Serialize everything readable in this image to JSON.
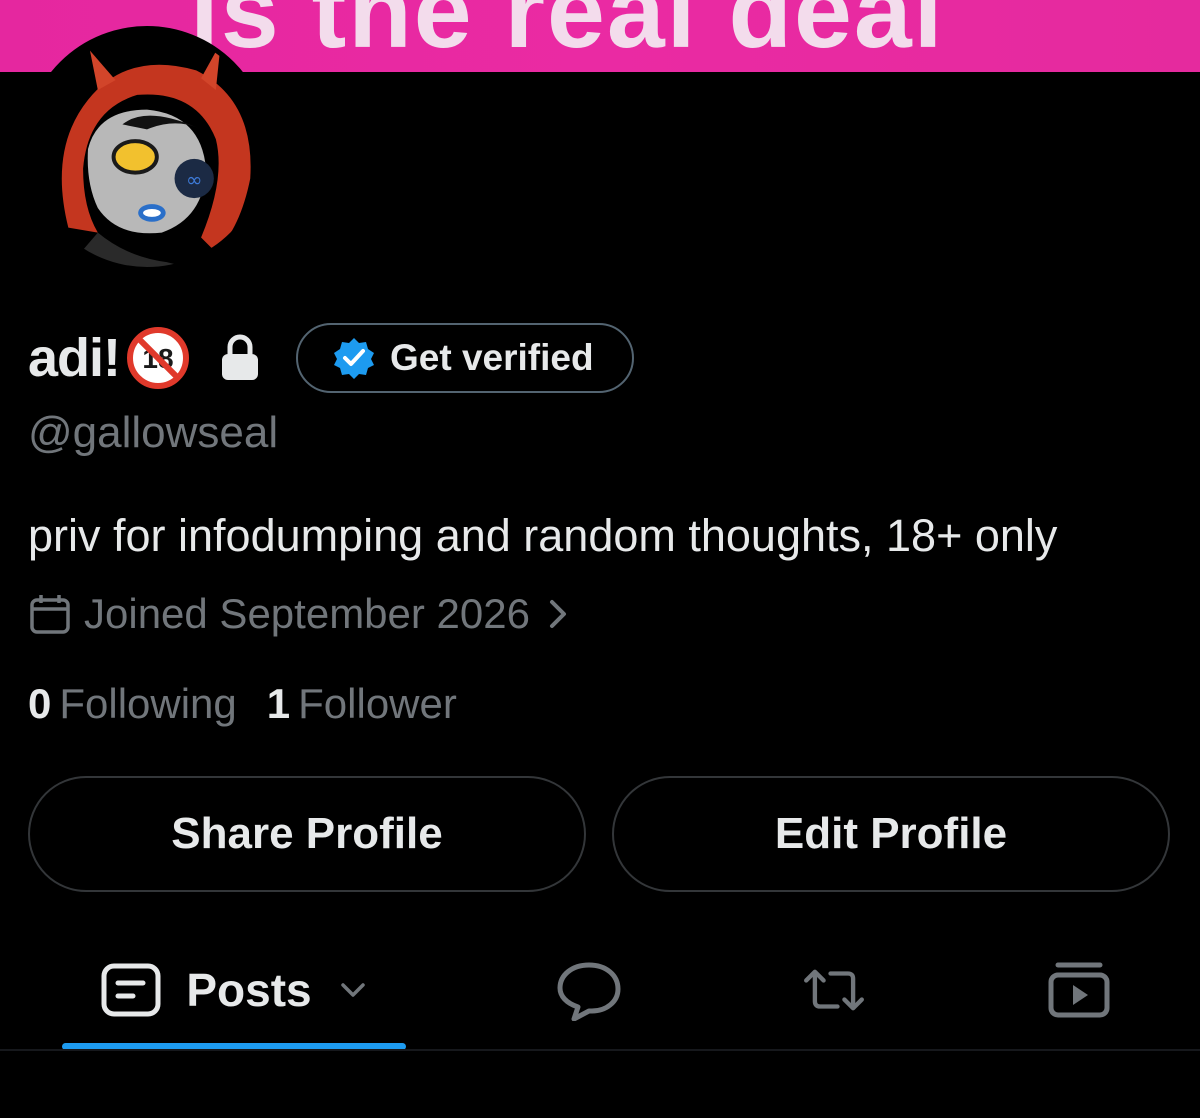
{
  "banner": {
    "text": "is the real deal",
    "color": "#e8279f"
  },
  "profile": {
    "display_name": "adi!",
    "age_badge_icon": "no-under-18-icon",
    "lock_icon": "lock-icon",
    "verify_button": {
      "label": "Get verified",
      "icon": "verified-badge-icon"
    },
    "handle": "@gallowseal",
    "bio": "priv for infodumping and random thoughts, 18+ only",
    "joined": {
      "icon": "calendar-icon",
      "text": "Joined September 2026",
      "chevron": "chevron-right-icon"
    },
    "stats": {
      "following_count": "0",
      "following_label": "Following",
      "followers_count": "1",
      "followers_label": "Follower"
    }
  },
  "actions": {
    "share_label": "Share Profile",
    "edit_label": "Edit Profile"
  },
  "tabs": [
    {
      "id": "posts",
      "label": "Posts",
      "icon": "posts-icon",
      "dropdown_icon": "chevron-down-icon",
      "active": true
    },
    {
      "id": "replies",
      "icon": "reply-bubble-icon"
    },
    {
      "id": "reposts",
      "icon": "repost-icon"
    },
    {
      "id": "media",
      "icon": "media-play-icon"
    }
  ],
  "colors": {
    "background": "#000000",
    "text": "#e7e9ea",
    "muted": "#71767b",
    "accent": "#1d9bf0",
    "border": "#333639"
  }
}
